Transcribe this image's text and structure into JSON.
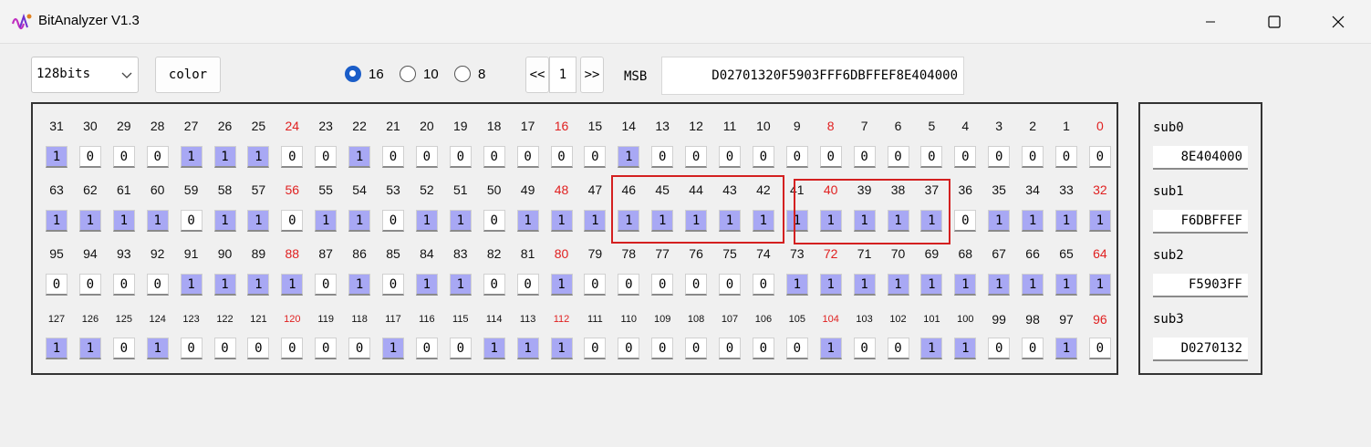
{
  "window": {
    "title": "BitAnalyzer V1.3",
    "icon": "app-logo-icon"
  },
  "toolbar": {
    "width_select": "128bits",
    "color_button": "color",
    "radix_options": [
      {
        "label": "16",
        "selected": true
      },
      {
        "label": "10",
        "selected": false
      },
      {
        "label": "8",
        "selected": false
      }
    ],
    "prev_label": "<<",
    "page": "1",
    "next_label": ">>",
    "msb_label": "MSB",
    "hex_value": "D02701320F5903FFF6DBFFEF8E404000"
  },
  "bit_rows": [
    {
      "indices": [
        "31",
        "30",
        "29",
        "28",
        "27",
        "26",
        "25",
        "24",
        "23",
        "22",
        "21",
        "20",
        "19",
        "18",
        "17",
        "16",
        "15",
        "14",
        "13",
        "12",
        "11",
        "10",
        "9",
        "8",
        "7",
        "6",
        "5",
        "4",
        "3",
        "2",
        "1",
        "0"
      ],
      "values": [
        "1",
        "0",
        "0",
        "0",
        "1",
        "1",
        "1",
        "0",
        "0",
        "1",
        "0",
        "0",
        "0",
        "0",
        "0",
        "0",
        "0",
        "1",
        "0",
        "0",
        "0",
        "0",
        "0",
        "0",
        "0",
        "0",
        "0",
        "0",
        "0",
        "0",
        "0",
        "0"
      ]
    },
    {
      "indices": [
        "63",
        "62",
        "61",
        "60",
        "59",
        "58",
        "57",
        "56",
        "55",
        "54",
        "53",
        "52",
        "51",
        "50",
        "49",
        "48",
        "47",
        "46",
        "45",
        "44",
        "43",
        "42",
        "41",
        "40",
        "39",
        "38",
        "37",
        "36",
        "35",
        "34",
        "33",
        "32"
      ],
      "values": [
        "1",
        "1",
        "1",
        "1",
        "0",
        "1",
        "1",
        "0",
        "1",
        "1",
        "0",
        "1",
        "1",
        "0",
        "1",
        "1",
        "1",
        "1",
        "1",
        "1",
        "1",
        "1",
        "1",
        "1",
        "1",
        "1",
        "1",
        "0",
        "1",
        "1",
        "1",
        "1"
      ]
    },
    {
      "indices": [
        "95",
        "94",
        "93",
        "92",
        "91",
        "90",
        "89",
        "88",
        "87",
        "86",
        "85",
        "84",
        "83",
        "82",
        "81",
        "80",
        "79",
        "78",
        "77",
        "76",
        "75",
        "74",
        "73",
        "72",
        "71",
        "70",
        "69",
        "68",
        "67",
        "66",
        "65",
        "64"
      ],
      "values": [
        "0",
        "0",
        "0",
        "0",
        "1",
        "1",
        "1",
        "1",
        "0",
        "1",
        "0",
        "1",
        "1",
        "0",
        "0",
        "1",
        "0",
        "0",
        "0",
        "0",
        "0",
        "0",
        "1",
        "1",
        "1",
        "1",
        "1",
        "1",
        "1",
        "1",
        "1",
        "1"
      ]
    },
    {
      "indices": [
        "127",
        "126",
        "125",
        "124",
        "123",
        "122",
        "121",
        "120",
        "119",
        "118",
        "117",
        "116",
        "115",
        "114",
        "113",
        "112",
        "111",
        "110",
        "109",
        "108",
        "107",
        "106",
        "105",
        "104",
        "103",
        "102",
        "101",
        "100",
        "99",
        "98",
        "97",
        "96"
      ],
      "values": [
        "1",
        "1",
        "0",
        "1",
        "0",
        "0",
        "0",
        "0",
        "0",
        "0",
        "1",
        "0",
        "0",
        "1",
        "1",
        "1",
        "0",
        "0",
        "0",
        "0",
        "0",
        "0",
        "0",
        "1",
        "0",
        "0",
        "1",
        "1",
        "0",
        "0",
        "1",
        "0"
      ]
    }
  ],
  "highlight_color": "#a8a8f4",
  "marker_color": "#e02020",
  "subs": [
    {
      "label": "sub0",
      "value": "8E404000"
    },
    {
      "label": "sub1",
      "value": "F6DBFFEF"
    },
    {
      "label": "sub2",
      "value": "F5903FF"
    },
    {
      "label": "sub3",
      "value": "D0270132"
    }
  ]
}
